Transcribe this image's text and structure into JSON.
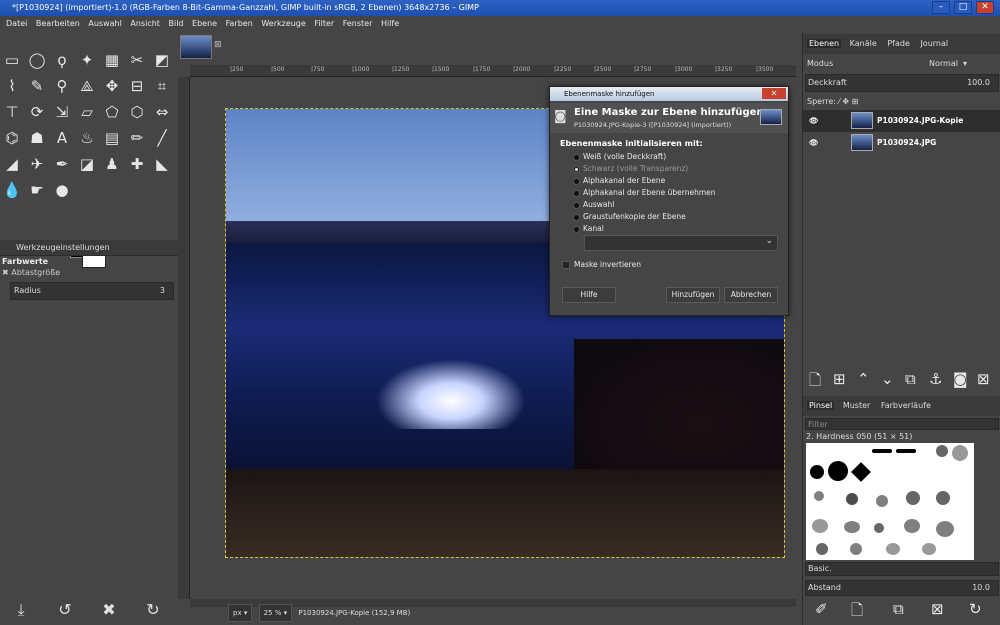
{
  "window": {
    "title": "*[P1030924] (importiert)-1.0 (RGB-Farben 8-Bit-Gamma-Ganzzahl, GIMP built-in sRGB, 2 Ebenen) 3648x2736 – GIMP",
    "controls": [
      "–",
      "□",
      "✕"
    ]
  },
  "menu": [
    "Datei",
    "Bearbeiten",
    "Auswahl",
    "Ansicht",
    "Bild",
    "Ebene",
    "Farben",
    "Werkzeuge",
    "Filter",
    "Fenster",
    "Hilfe"
  ],
  "tool_options": {
    "tab_label": "Werkzeugeinstellungen",
    "section": "Farbwerte",
    "sample_label": "Abtastgröße",
    "radius_label": "Radius",
    "radius_value": "3"
  },
  "ruler": {
    "ticks": [
      "|250",
      "|500",
      "|750",
      "|1000",
      "|1250",
      "|1500",
      "|1750",
      "|2000",
      "|2250",
      "|2500",
      "|2750",
      "|3000",
      "|3250",
      "|3500"
    ]
  },
  "status": {
    "unit": "px",
    "zoom": "25 %",
    "layer_info": "P1030924.JPG-Kopie (152,9 MB)"
  },
  "dock": {
    "tabs_top": [
      "Ebenen",
      "Kanäle",
      "Pfade",
      "Journal"
    ],
    "mode_label": "Modus",
    "mode_value": "Normal",
    "opacity_label": "Deckkraft",
    "opacity_value": "100.0",
    "lock_label": "Sperre:",
    "layers": [
      {
        "name": "P1030924.JPG-Kopie",
        "visible": true
      },
      {
        "name": "P1030924.JPG",
        "visible": true
      }
    ],
    "tabs_bottom": [
      "Pinsel",
      "Muster",
      "Farbverläufe"
    ],
    "filter_placeholder": "Filter",
    "brush_name": "2. Hardness 050 (51 × 51)",
    "brush_preset": "Basic.",
    "spacing_label": "Abstand",
    "spacing_value": "10.0"
  },
  "dialog": {
    "title": "Ebenenmaske hinzufügen",
    "heading": "Eine Maske zur Ebene hinzufügen",
    "subheading": "P1030924.JPG-Kopie-3 ([P1030924] (importiert))",
    "section": "Ebenenmaske initialisieren mit:",
    "options": [
      {
        "label": "Weiß (volle Deckkraft)",
        "selected": false
      },
      {
        "label": "Schwarz (volle Transparenz)",
        "selected": true
      },
      {
        "label": "Alphakanal der Ebene",
        "selected": false
      },
      {
        "label": "Alphakanal der Ebene übernehmen",
        "selected": false
      },
      {
        "label": "Auswahl",
        "selected": false
      },
      {
        "label": "Graustufenkopie der Ebene",
        "selected": false
      },
      {
        "label": "Kanal",
        "selected": false
      }
    ],
    "invert_label": "Maske invertieren",
    "help_button": "Hilfe",
    "add_button": "Hinzufügen",
    "cancel_button": "Abbrechen"
  }
}
